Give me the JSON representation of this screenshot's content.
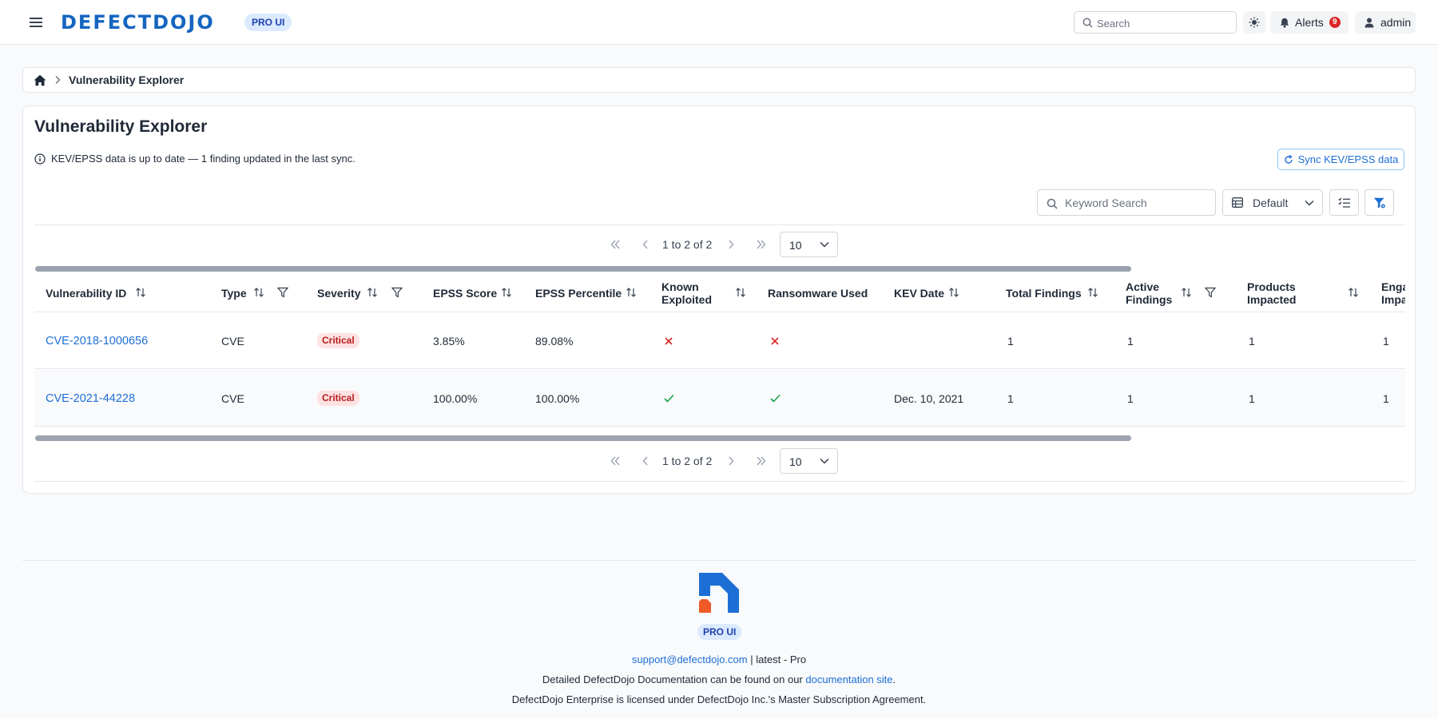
{
  "navbar": {
    "logo_text": "DEFECTDOJO",
    "pro_badge": "PRO UI",
    "search_placeholder": "Search",
    "alerts_label": "Alerts",
    "alerts_count": "9",
    "user_label": "admin"
  },
  "breadcrumb": {
    "current": "Vulnerability Explorer"
  },
  "page": {
    "title": "Vulnerability Explorer",
    "info_text": "KEV/EPSS data is up to date — 1 finding updated in the last sync.",
    "sync_button": "Sync KEV/EPSS data",
    "keyword_placeholder": "Keyword Search",
    "view_select": "Default"
  },
  "pagination": {
    "range_text": "1 to 2 of 2",
    "page_size": "10"
  },
  "table": {
    "columns": [
      {
        "label": "Vulnerability ID",
        "sort": true,
        "filter": false
      },
      {
        "label": "Type",
        "sort": true,
        "filter": true
      },
      {
        "label": "Severity",
        "sort": true,
        "filter": true
      },
      {
        "label": "EPSS Score",
        "sort": true,
        "filter": false
      },
      {
        "label": "EPSS Percentile",
        "sort": true,
        "filter": false
      },
      {
        "label": "Known Exploited",
        "sort": true,
        "filter": false
      },
      {
        "label": "Ransomware Used",
        "sort": false,
        "filter": false
      },
      {
        "label": "KEV Date",
        "sort": true,
        "filter": false
      },
      {
        "label": "Total Findings",
        "sort": true,
        "filter": false
      },
      {
        "label": "Active Findings",
        "sort": true,
        "filter": true
      },
      {
        "label": "Products Impacted",
        "sort": true,
        "filter": false
      },
      {
        "label": "Engagements Impacted",
        "sort": false,
        "filter": false
      }
    ],
    "rows": [
      {
        "vuln_id": "CVE-2018-1000656",
        "type": "CVE",
        "severity": "Critical",
        "epss_score": "3.85%",
        "epss_percentile": "89.08%",
        "known_exploited": false,
        "ransomware_used": false,
        "kev_date": "",
        "total_findings": "1",
        "active_findings": "1",
        "products_impacted": "1",
        "engagements_impacted": "1"
      },
      {
        "vuln_id": "CVE-2021-44228",
        "type": "CVE",
        "severity": "Critical",
        "epss_score": "100.00%",
        "epss_percentile": "100.00%",
        "known_exploited": true,
        "ransomware_used": true,
        "kev_date": "Dec. 10, 2021",
        "total_findings": "1",
        "active_findings": "1",
        "products_impacted": "1",
        "engagements_impacted": "1"
      }
    ]
  },
  "footer": {
    "pro_badge": "PRO UI",
    "support_email": "support@defectdojo.com",
    "version_text": " | latest - Pro",
    "docs_prefix": "Detailed DefectDojo Documentation can be found on our ",
    "docs_link": "documentation site",
    "docs_suffix": ".",
    "license_text": "DefectDojo Enterprise is licensed under DefectDojo Inc.'s Master Subscription Agreement."
  },
  "colors": {
    "brand_blue": "#1565c0",
    "link_blue": "#1d6fd6",
    "critical_bg": "#fde2e2",
    "critical_text": "#b91c1c",
    "check_green": "#16a34a",
    "cross_red": "#dc2626",
    "logo_orange": "#f05a28"
  }
}
